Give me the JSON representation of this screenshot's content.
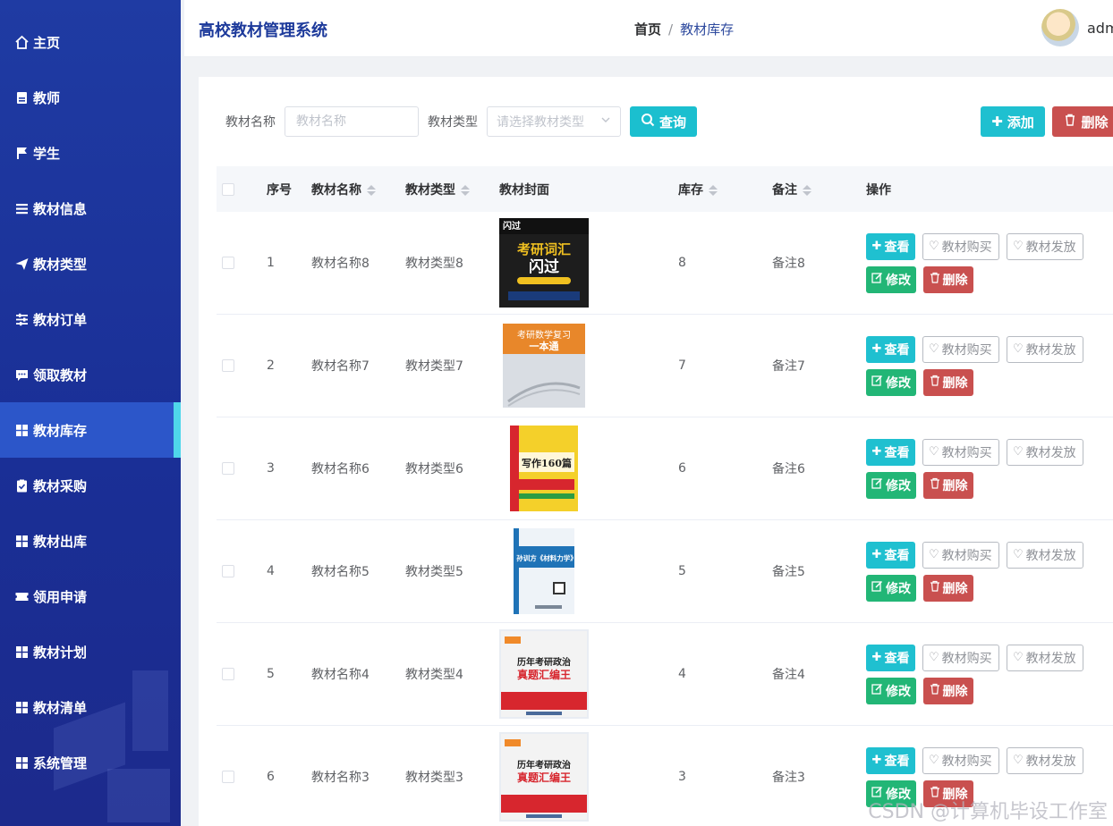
{
  "header": {
    "app_title": "高校教材管理系统",
    "breadcrumb_home": "首页",
    "breadcrumb_sep": "/",
    "breadcrumb_current": "教材库存",
    "user_name": "adm"
  },
  "sidebar": {
    "items": [
      {
        "label": "主页",
        "icon": "home-icon"
      },
      {
        "label": "教师",
        "icon": "id-card-icon"
      },
      {
        "label": "学生",
        "icon": "flag-icon"
      },
      {
        "label": "教材信息",
        "icon": "list-icon"
      },
      {
        "label": "教材类型",
        "icon": "send-icon"
      },
      {
        "label": "教材订单",
        "icon": "sliders-icon"
      },
      {
        "label": "领取教材",
        "icon": "chat-icon"
      },
      {
        "label": "教材库存",
        "icon": "grid-icon",
        "active": true
      },
      {
        "label": "教材采购",
        "icon": "clipboard-check-icon"
      },
      {
        "label": "教材出库",
        "icon": "grid-icon"
      },
      {
        "label": "领用申请",
        "icon": "ticket-icon"
      },
      {
        "label": "教材计划",
        "icon": "grid-icon"
      },
      {
        "label": "教材清单",
        "icon": "grid-icon"
      },
      {
        "label": "系统管理",
        "icon": "grid-icon"
      }
    ]
  },
  "search": {
    "name_label": "教材名称",
    "name_placeholder": "教材名称",
    "type_label": "教材类型",
    "type_placeholder": "请选择教材类型",
    "query_label": "查询"
  },
  "toolbar": {
    "add_label": "添加",
    "delete_label": "删除"
  },
  "table": {
    "columns": [
      "序号",
      "教材名称",
      "教材类型",
      "教材封面",
      "库存",
      "备注",
      "操作"
    ],
    "action_labels": {
      "view": "查看",
      "buy": "教材购买",
      "give": "教材发放",
      "edit": "修改",
      "delete": "删除"
    },
    "rows": [
      {
        "no": "1",
        "name": "教材名称8",
        "type": "教材类型8",
        "stock": "8",
        "note": "备注8",
        "cover_title": "考研词汇 闪过",
        "cover_color": "#1d1d1d",
        "cover_accent": "#f0c020"
      },
      {
        "no": "2",
        "name": "教材名称7",
        "type": "教材类型7",
        "stock": "7",
        "note": "备注7",
        "cover_title": "考研数学复习 一本通",
        "cover_color": "#d9dde3",
        "cover_accent": "#e8872a"
      },
      {
        "no": "3",
        "name": "教材名称6",
        "type": "教材类型6",
        "stock": "6",
        "note": "备注6",
        "cover_title": "写作160篇",
        "cover_color": "#f4d02a",
        "cover_accent": "#d7262e"
      },
      {
        "no": "4",
        "name": "教材名称5",
        "type": "教材类型5",
        "stock": "5",
        "note": "备注5",
        "cover_title": "孙训方《材料力学》",
        "cover_color": "#eef3f8",
        "cover_accent": "#1f73b7"
      },
      {
        "no": "5",
        "name": "教材名称4",
        "type": "教材类型4",
        "stock": "4",
        "note": "备注4",
        "cover_title": "历年考研政治 真题汇编王",
        "cover_color": "#f3f3f3",
        "cover_accent": "#d7262e"
      },
      {
        "no": "6",
        "name": "教材名称3",
        "type": "教材类型3",
        "stock": "3",
        "note": "备注3",
        "cover_title": "历年考研政治 真题汇编王",
        "cover_color": "#f3f3f3",
        "cover_accent": "#d7262e"
      }
    ]
  },
  "watermark": "CSDN @计算机毕设工作室"
}
